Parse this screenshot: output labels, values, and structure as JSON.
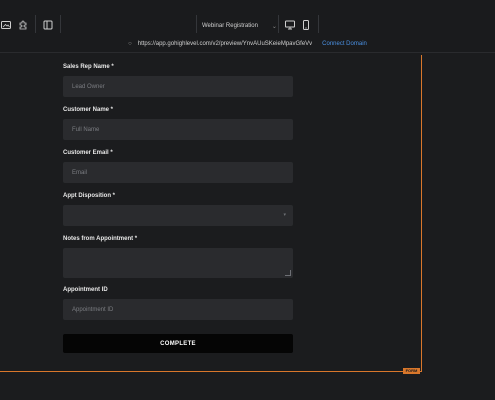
{
  "toolbar": {
    "page_selector": "Webinar Registration",
    "icons": [
      "image-icon",
      "puzzle-icon",
      "layout-icon",
      "desktop-icon",
      "mobile-icon",
      "chevron-down-icon",
      "lock-icon"
    ]
  },
  "url_bar": {
    "url": "https://app.gohighlevel.com/v2/preview/YnvAUuSKeieMpavGfeVv",
    "connect_label": "Connect Domain"
  },
  "form": {
    "tag": "FORM",
    "fields": [
      {
        "label": "Sales Rep Name *",
        "placeholder": "Lead Owner"
      },
      {
        "label": "Customer Name *",
        "placeholder": "Full Name"
      },
      {
        "label": "Customer Email *",
        "placeholder": "Email"
      },
      {
        "label": "Appt Disposition *",
        "placeholder": ""
      },
      {
        "label": "Notes from Appointment *",
        "placeholder": ""
      },
      {
        "label": "Appointment ID",
        "placeholder": "Appointment ID"
      }
    ],
    "submit_label": "COMPLETE"
  },
  "colors": {
    "background": "#1b1c1e",
    "input_bg": "#2a2b2e",
    "accent_orange": "#d9772b",
    "link_blue": "#4a90e2",
    "button_bg": "#050505"
  }
}
